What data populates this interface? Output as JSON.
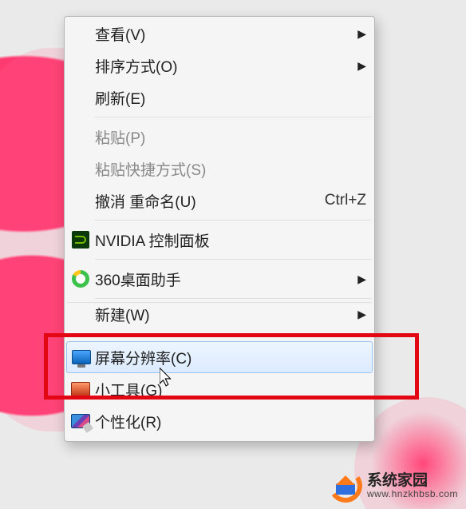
{
  "menu": {
    "view": {
      "label": "查看(V)"
    },
    "sort": {
      "label": "排序方式(O)"
    },
    "refresh": {
      "label": "刷新(E)"
    },
    "paste": {
      "label": "粘贴(P)"
    },
    "paste_shortcut": {
      "label": "粘贴快捷方式(S)"
    },
    "undo": {
      "label": "撤消 重命名(U)",
      "shortcut": "Ctrl+Z"
    },
    "nvidia": {
      "label": "NVIDIA 控制面板"
    },
    "360": {
      "label": "360桌面助手"
    },
    "new": {
      "label": "新建(W)"
    },
    "resolution": {
      "label": "屏幕分辨率(C)"
    },
    "gadgets": {
      "label": "小工具(G)"
    },
    "personalize": {
      "label": "个性化(R)"
    }
  },
  "logo": {
    "title": "系统家园",
    "url": "www.hnzkhbsb.com"
  }
}
